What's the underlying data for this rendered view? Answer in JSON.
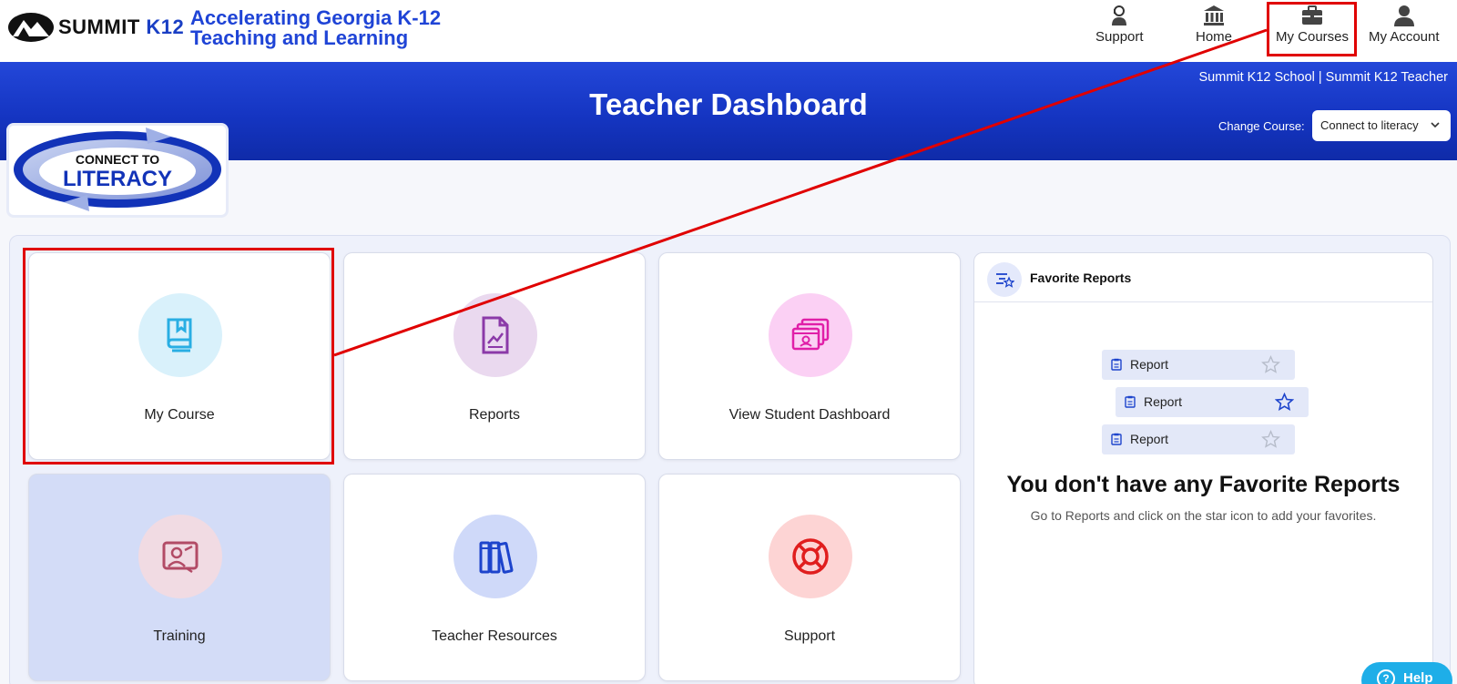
{
  "brand": {
    "logo_text": "SUMMIT",
    "logo_k12": "K12",
    "tagline_line1": "Accelerating Georgia K-12",
    "tagline_line2": "Teaching and Learning"
  },
  "nav": {
    "support": "Support",
    "home": "Home",
    "my_courses": "My Courses",
    "my_account": "My Account"
  },
  "banner": {
    "title": "Teacher Dashboard",
    "user_line": "Summit K12 School | Summit K12 Teacher",
    "change_course_label": "Change Course:",
    "selected_course": "Connect to literacy"
  },
  "course_logo": {
    "line1": "CONNECT TO",
    "line2": "LITERACY"
  },
  "tiles": [
    {
      "label": "My Course",
      "icon": "book-icon",
      "circle_color": "#d9f1fb",
      "icon_color": "#29aee3"
    },
    {
      "label": "Reports",
      "icon": "report-chart-icon",
      "circle_color": "#ead9ef",
      "icon_color": "#8b3aa8"
    },
    {
      "label": "View Student Dashboard",
      "icon": "student-dashboard-icon",
      "circle_color": "#fbd0f4",
      "icon_color": "#e01fa8"
    },
    {
      "label": "Training",
      "icon": "training-icon",
      "circle_color": "#f1dbe3",
      "icon_color": "#b24b66"
    },
    {
      "label": "Teacher Resources",
      "icon": "books-icon",
      "circle_color": "#cfd9f9",
      "icon_color": "#1d44cc"
    },
    {
      "label": "Support",
      "icon": "lifebuoy-icon",
      "circle_color": "#fdd4d4",
      "icon_color": "#e01e1e"
    }
  ],
  "favorites": {
    "title": "Favorite Reports",
    "items": [
      {
        "label": "Report",
        "starred": false
      },
      {
        "label": "Report",
        "starred": true
      },
      {
        "label": "Report",
        "starred": false
      }
    ],
    "empty_title": "You don't have any Favorite Reports",
    "empty_hint": "Go to Reports and click on the star icon to add your favorites."
  },
  "help": {
    "label": "Help"
  },
  "colors": {
    "brand_blue": "#1f44d6",
    "banner_blue": "#1535c2",
    "annotation_red": "#e00000"
  }
}
